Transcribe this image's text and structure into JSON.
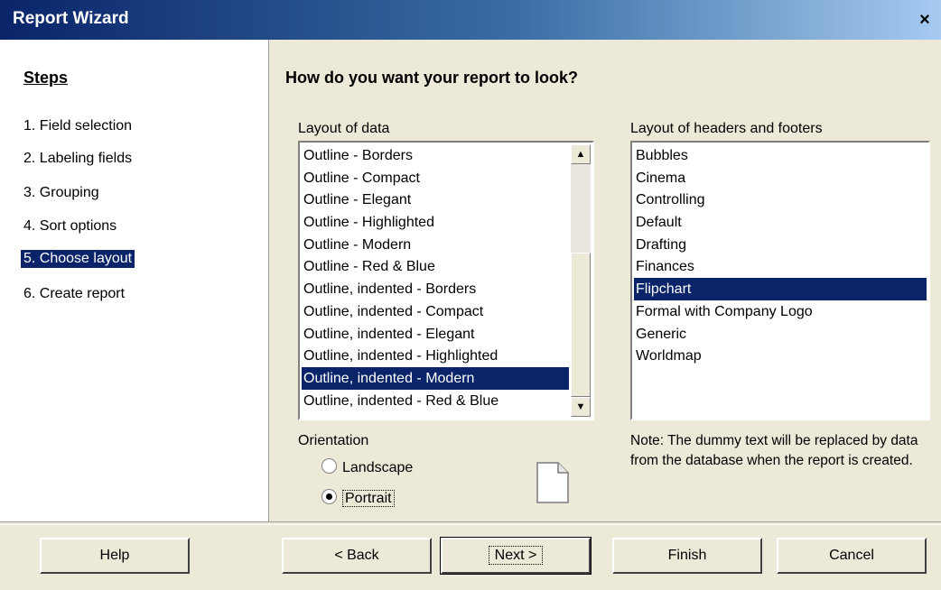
{
  "window": {
    "title": "Report Wizard",
    "close_symbol": "×"
  },
  "steps": {
    "title": "Steps",
    "items": [
      {
        "label": "1. Field selection"
      },
      {
        "label": "2. Labeling fields"
      },
      {
        "label": "3. Grouping"
      },
      {
        "label": "4. Sort options"
      },
      {
        "label": "5. Choose layout"
      },
      {
        "label": "6. Create report"
      }
    ],
    "active_index": 4
  },
  "main": {
    "heading": "How do you want your report to look?",
    "layout_data": {
      "label": "Layout of data",
      "items": [
        "Outline - Borders",
        "Outline - Compact",
        "Outline - Elegant",
        "Outline - Highlighted",
        "Outline - Modern",
        "Outline - Red & Blue",
        "Outline, indented - Borders",
        "Outline, indented - Compact",
        "Outline, indented - Elegant",
        "Outline, indented - Highlighted",
        "Outline, indented - Modern",
        "Outline, indented - Red & Blue"
      ],
      "selected": "Outline, indented - Modern"
    },
    "layout_headers": {
      "label": "Layout of headers and footers",
      "items": [
        "Bubbles",
        "Cinema",
        "Controlling",
        "Default",
        "Drafting",
        "Finances",
        "Flipchart",
        "Formal with Company Logo",
        "Generic",
        "Worldmap"
      ],
      "selected": "Flipchart"
    },
    "orientation": {
      "label": "Orientation",
      "options": [
        "Landscape",
        "Portrait"
      ],
      "selected": "Portrait"
    },
    "note": "Note: The dummy text will be replaced by data from the database when the report is created."
  },
  "buttons": {
    "help": "Help",
    "back": "< Back",
    "next": "Next >",
    "finish": "Finish",
    "cancel": "Cancel"
  }
}
